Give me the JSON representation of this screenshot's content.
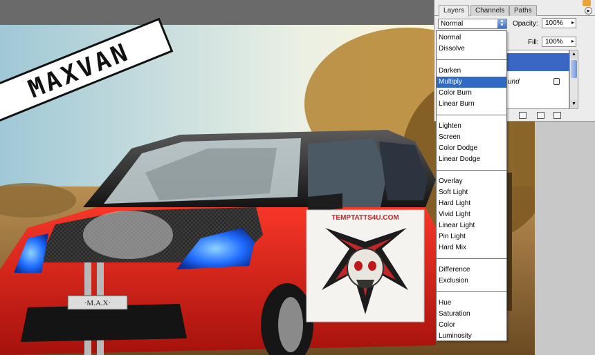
{
  "artwork": {
    "logo_text": "MAXVAN",
    "plate_text": "·M.A.X·",
    "tattoo_site": "TEMPTATTS4U.COM"
  },
  "layers_panel": {
    "tabs": [
      "Layers",
      "Channels",
      "Paths"
    ],
    "blend_mode_value": "Normal",
    "opacity_label": "Opacity:",
    "opacity_value": "100%",
    "fill_label": "Fill:",
    "fill_value": "100%",
    "background_layer_name": "und"
  },
  "blend_menu": {
    "groups": [
      [
        "Normal",
        "Dissolve"
      ],
      [
        "Darken",
        "Multiply",
        "Color Burn",
        "Linear Burn"
      ],
      [
        "Lighten",
        "Screen",
        "Color Dodge",
        "Linear Dodge"
      ],
      [
        "Overlay",
        "Soft Light",
        "Hard Light",
        "Vivid Light",
        "Linear Light",
        "Pin Light",
        "Hard Mix"
      ],
      [
        "Difference",
        "Exclusion"
      ],
      [
        "Hue",
        "Saturation",
        "Color",
        "Luminosity"
      ]
    ],
    "highlighted": "Multiply"
  },
  "colors": {
    "selection_blue": "#316ac5",
    "car_red": "#d8201a",
    "headlight_blue": "#1f6cff"
  }
}
